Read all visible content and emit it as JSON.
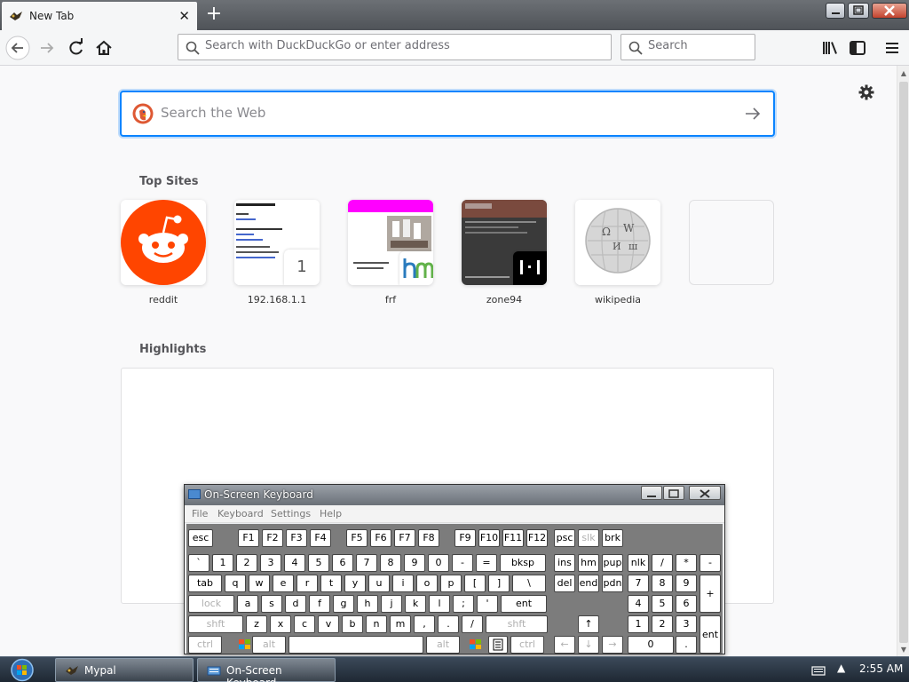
{
  "browser": {
    "tab_title": "New Tab",
    "urlbar_placeholder": "Search with DuckDuckGo or enter address",
    "searchbar_placeholder": "Search"
  },
  "newtab": {
    "search_placeholder": "Search the Web",
    "top_sites_title": "Top Sites",
    "top_sites": [
      {
        "label": "reddit"
      },
      {
        "label": "192.168.1.1",
        "badge": "1"
      },
      {
        "label": "frf"
      },
      {
        "label": "zone94"
      },
      {
        "label": "wikipedia"
      },
      {
        "label": ""
      }
    ],
    "highlights_title": "Highlights"
  },
  "osk": {
    "title": "On-Screen Keyboard",
    "menu": [
      "File",
      "Keyboard",
      "Settings",
      "Help"
    ],
    "rows": [
      [
        "esc",
        "F1",
        "F2",
        "F3",
        "F4",
        "F5",
        "F6",
        "F7",
        "F8",
        "F9",
        "F10",
        "F11",
        "F12",
        "psc",
        "slk",
        "brk"
      ],
      [
        "`",
        "1",
        "2",
        "3",
        "4",
        "5",
        "6",
        "7",
        "8",
        "9",
        "0",
        "-",
        "=",
        "bksp",
        "ins",
        "hm",
        "pup",
        "nlk",
        "/",
        "*",
        "-"
      ],
      [
        "tab",
        "q",
        "w",
        "e",
        "r",
        "t",
        "y",
        "u",
        "i",
        "o",
        "p",
        "[",
        "]",
        "\\",
        "del",
        "end",
        "pdn",
        "7",
        "8",
        "9",
        "+"
      ],
      [
        "lock",
        "a",
        "s",
        "d",
        "f",
        "g",
        "h",
        "j",
        "k",
        "l",
        ";",
        "'",
        "ent",
        "4",
        "5",
        "6"
      ],
      [
        "shft",
        "z",
        "x",
        "c",
        "v",
        "b",
        "n",
        "m",
        ",",
        ".",
        "/",
        "shft",
        "↑",
        "1",
        "2",
        "3"
      ],
      [
        "ctrl",
        "alt",
        "alt",
        "ctrl",
        "←",
        "↓",
        "→",
        "0",
        ".",
        "ent"
      ]
    ]
  },
  "taskbar": {
    "tasks": [
      "Mypal",
      "On-Screen Keyboard"
    ],
    "clock": "2:55 AM"
  },
  "colors": {
    "accent": "#0a84ff",
    "reddit": "#ff4500"
  }
}
